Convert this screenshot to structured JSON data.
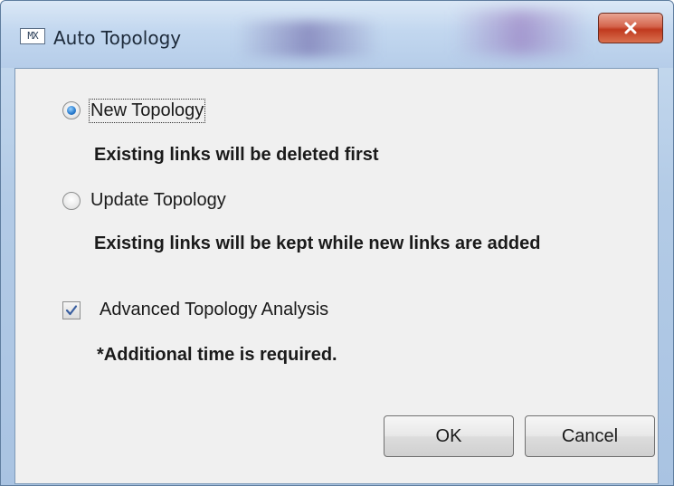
{
  "window": {
    "title": "Auto Topology",
    "app_icon_text": "MX",
    "close_icon": "close-icon"
  },
  "options": {
    "new_topology": {
      "label": "New Topology",
      "description": "Existing links will be deleted first",
      "selected": true
    },
    "update_topology": {
      "label": "Update Topology",
      "description": "Existing links will be kept while new links are added",
      "selected": false
    },
    "advanced_analysis": {
      "label": "Advanced Topology Analysis",
      "note": "*Additional time is required.",
      "checked": true
    }
  },
  "buttons": {
    "ok_label": "OK",
    "cancel_label": "Cancel"
  },
  "colors": {
    "radio_accent": "#2c7fd1",
    "checkbox_check": "#3a5fa0",
    "close_button": "#c0391e"
  }
}
